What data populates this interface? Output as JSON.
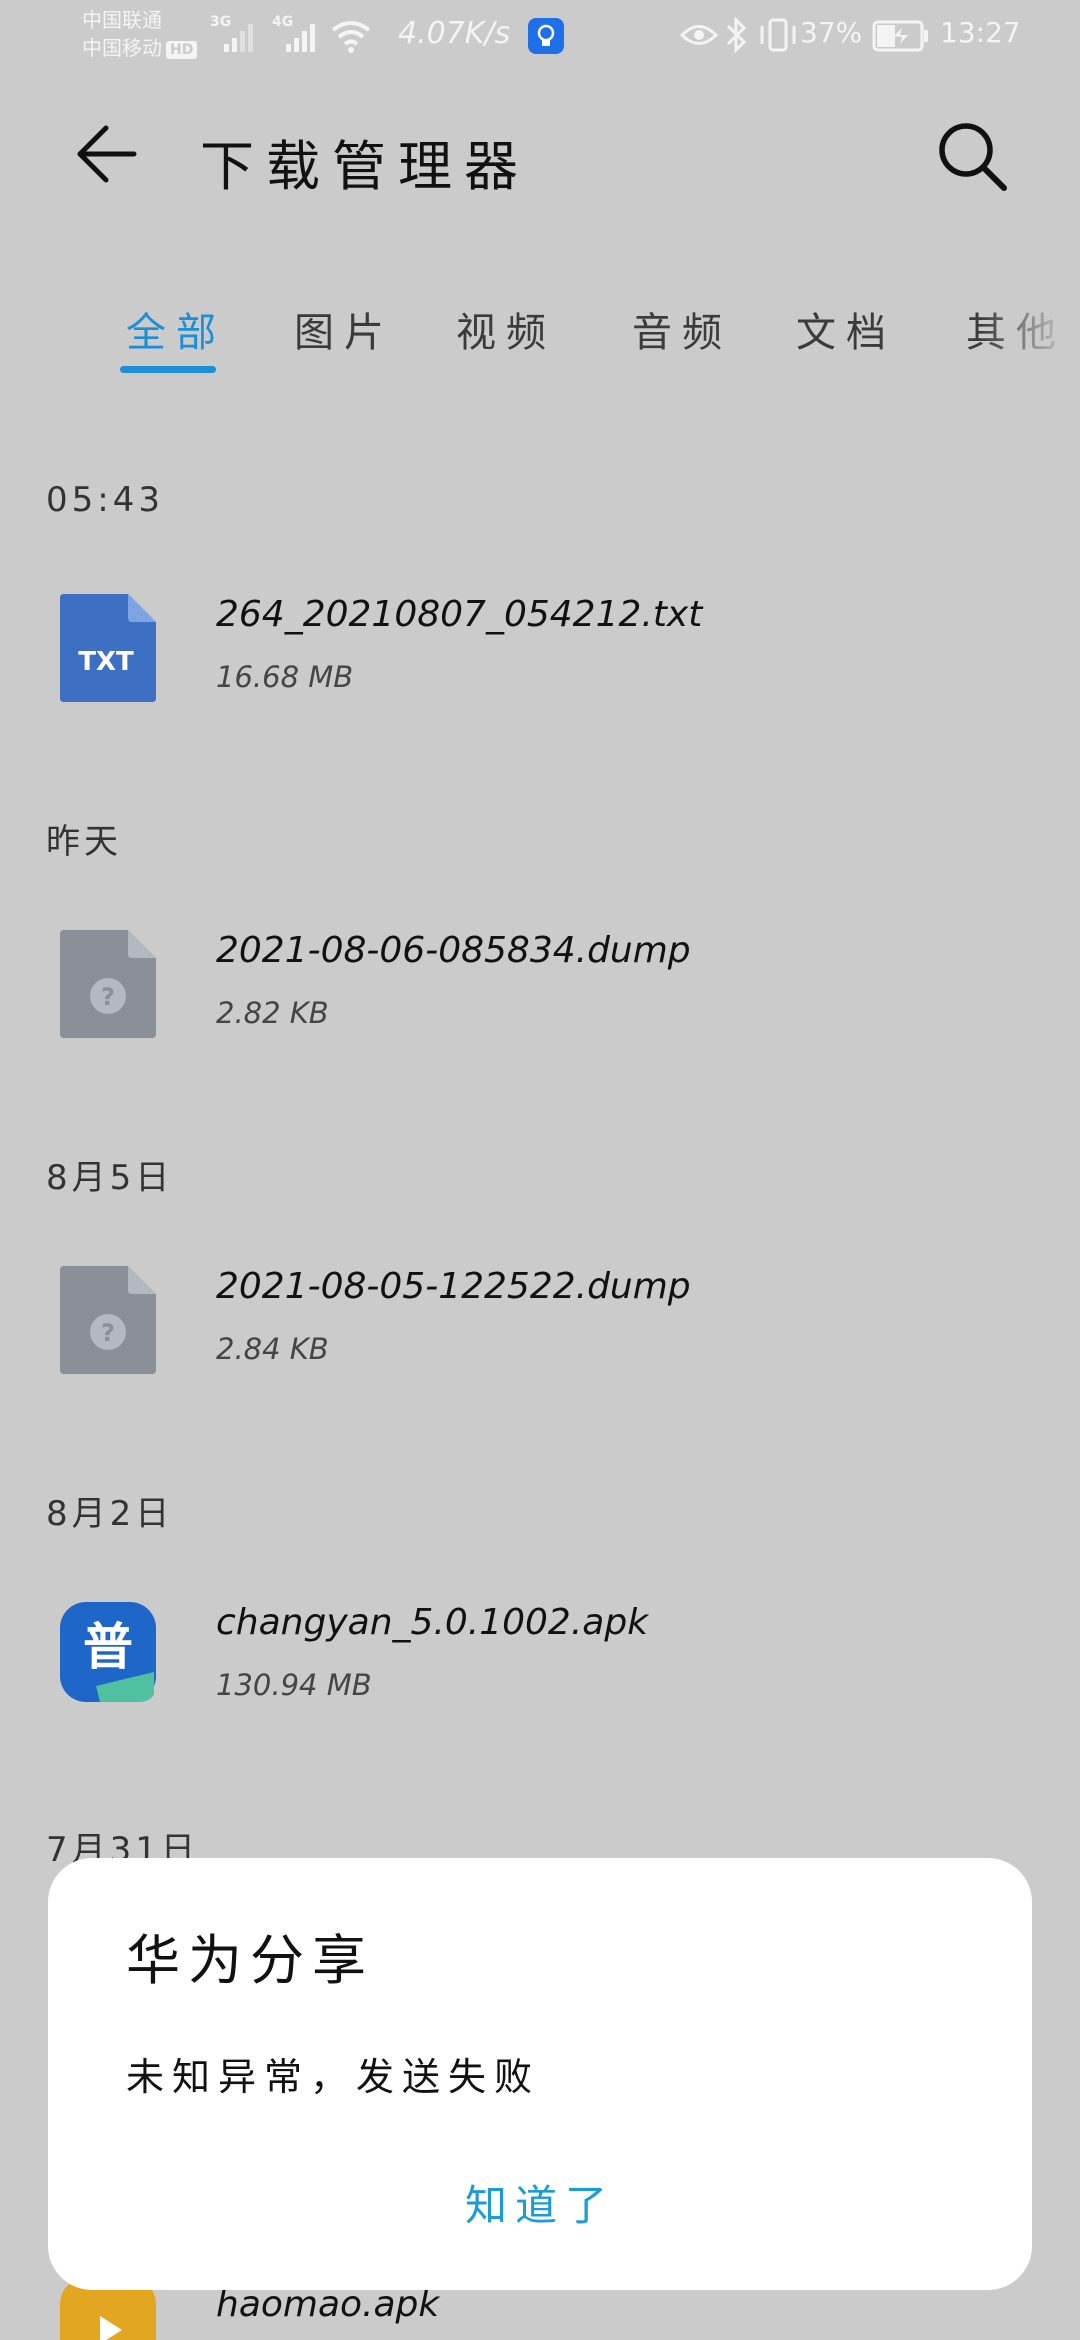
{
  "status_bar": {
    "carrier_top": "中国联通",
    "carrier_bottom": "中国移动",
    "hd_label": "HD",
    "signal_1_label": "3G",
    "signal_2_label": "4G",
    "net_speed": "4.07K/s",
    "battery_percent": "37%",
    "time": "13:27"
  },
  "header": {
    "title": "下载管理器",
    "back_icon": "back-arrow-icon",
    "search_icon": "search-icon"
  },
  "tabs": {
    "active_index": 0,
    "items": [
      {
        "label": "全部"
      },
      {
        "label": "图片"
      },
      {
        "label": "视频"
      },
      {
        "label": "音频"
      },
      {
        "label": "文档"
      },
      {
        "label": "其他"
      }
    ]
  },
  "sections": [
    {
      "header": "05:43",
      "files": [
        {
          "name": "264_20210807_054212.txt",
          "size": "16.68 MB",
          "icon": "txt-file-icon",
          "icon_text": "TXT"
        }
      ]
    },
    {
      "header": "昨天",
      "files": [
        {
          "name": "2021-08-06-085834.dump",
          "size": "2.82 KB",
          "icon": "unknown-file-icon"
        }
      ]
    },
    {
      "header": "8月5日",
      "files": [
        {
          "name": "2021-08-05-122522.dump",
          "size": "2.84 KB",
          "icon": "unknown-file-icon"
        }
      ]
    },
    {
      "header": "8月2日",
      "files": [
        {
          "name": "changyan_5.0.1002.apk",
          "size": "130.94 MB",
          "icon": "changyan-app-icon",
          "icon_text": "普"
        }
      ]
    },
    {
      "header": "7月31日",
      "files": [
        {
          "name": "haomao.apk",
          "size": "",
          "icon": "haomao-app-icon"
        }
      ]
    }
  ],
  "dialog": {
    "title": "华为分享",
    "message": "未知异常，发送失败",
    "button_label": "知道了"
  },
  "colors": {
    "accent": "#1d8fd6",
    "dialog_button": "#1d9bd8",
    "background": "#cbcbcb",
    "txt_icon": "#3d6fc3",
    "unknown_icon": "#8a8f98",
    "changyan_icon": "#1f66c9",
    "haomao_icon": "#e3a620"
  }
}
